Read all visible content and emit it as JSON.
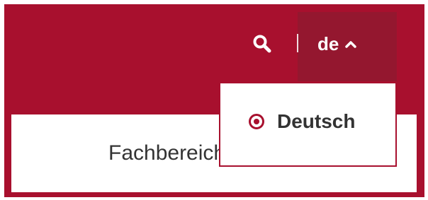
{
  "header": {
    "search_icon": "search-icon",
    "language_code": "de",
    "language_toggle_icon": "chevron-up-icon"
  },
  "language_menu": {
    "options": [
      {
        "label": "Deutsch",
        "selected": true
      }
    ]
  },
  "content": {
    "label": "Fachbereiche"
  },
  "colors": {
    "brand": "#a8102e",
    "brand_dark": "#94172f",
    "text": "#333333"
  }
}
